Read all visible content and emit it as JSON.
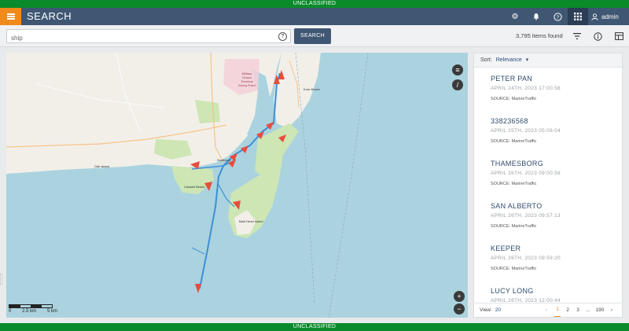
{
  "banner": {
    "top": "UNCLASSIFIED",
    "bottom": "UNCLASSIFIED"
  },
  "app": {
    "title": "SEARCH"
  },
  "topbar": {
    "icons": [
      "gear-icon",
      "bell-icon",
      "help-icon",
      "apps-grid-icon"
    ],
    "user_name": "admin"
  },
  "search": {
    "value": "ship",
    "placeholder": "ship",
    "button_label": "SEARCH",
    "items_found": "3,795 items found"
  },
  "map": {
    "scale_labels": [
      "0",
      "2.5 km",
      "5 km"
    ],
    "zoom_in": "+",
    "zoom_out": "−",
    "place_labels": [
      "Military Ocean Terminal Sunny Point",
      "Kure Beach",
      "Southport",
      "Caswell Beach",
      "Oak Island",
      "Bald Head Island"
    ],
    "colors": {
      "water": "#aad3df",
      "land": "#f2efe9",
      "green": "#cde6b4",
      "track": "#3c8fd6",
      "marker": "#e74c3c"
    }
  },
  "panel": {
    "sort_label": "Sort:",
    "sort_value": "Relevance",
    "results": [
      {
        "name": "PETER PAN",
        "date": "APRIL 24TH, 2023 17:00:58",
        "source": "SOURCE: MarineTraffic"
      },
      {
        "name": "338236568",
        "date": "APRIL 25TH, 2023 05:08:04",
        "source": "SOURCE: MarineTraffic"
      },
      {
        "name": "THAMESBORG",
        "date": "APRIL 26TH, 2023 09:00:58",
        "source": "SOURCE: MarineTraffic"
      },
      {
        "name": "SAN ALBERTO",
        "date": "APRIL 26TH, 2023 09:57:13",
        "source": "SOURCE: MarineTraffic"
      },
      {
        "name": "KEEPER",
        "date": "APRIL 26TH, 2023 09:59:20",
        "source": "SOURCE: MarineTraffic"
      },
      {
        "name": "LUCY LONG",
        "date": "APRIL 26TH, 2023 12:00:44",
        "source": ""
      }
    ],
    "pager": {
      "view_label": "View:",
      "view_value": "20",
      "prev": "‹",
      "pages": [
        "1",
        "2",
        "3",
        "...",
        "190"
      ],
      "next": "›"
    }
  }
}
